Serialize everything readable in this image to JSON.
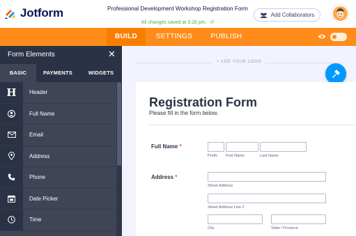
{
  "header": {
    "brand": "Jotform",
    "form_title": "Professional Development Workshop Registration Form",
    "saved_status": "All changes saved at 3:28 pm.",
    "collab_label": "Add Collaborators"
  },
  "nav": {
    "build": "BUILD",
    "settings": "SETTINGS",
    "publish": "PUBLISH"
  },
  "sidebar": {
    "title": "Form Elements",
    "close": "✕",
    "tabs": {
      "basic": "BASIC",
      "payments": "PAYMENTS",
      "widgets": "WIDGETS"
    },
    "items": [
      {
        "label": "Header",
        "icon": "header-icon"
      },
      {
        "label": "Full Name",
        "icon": "user-icon"
      },
      {
        "label": "Email",
        "icon": "envelope-icon"
      },
      {
        "label": "Address",
        "icon": "location-pin-icon"
      },
      {
        "label": "Phone",
        "icon": "phone-icon"
      },
      {
        "label": "Date Picker",
        "icon": "calendar-icon"
      },
      {
        "label": "Time",
        "icon": "clock-icon"
      }
    ]
  },
  "canvas": {
    "add_logo": "+ ADD YOUR LOGO",
    "form": {
      "heading": "Registration Form",
      "subheading": "Please fill in the form below.",
      "full_name": {
        "label": "Full Name",
        "required_mark": "*",
        "sublabels": {
          "prefix": "Prefix",
          "first": "First Name",
          "last": "Last Name"
        }
      },
      "address": {
        "label": "Address",
        "required_mark": "*",
        "sublabels": {
          "street": "Street Address",
          "street2": "Street Address Line 2",
          "city": "City",
          "state": "State / Province"
        }
      }
    }
  },
  "colors": {
    "accent": "#ff8c1a",
    "sidebar": "#3f4457",
    "fab": "#0099ff",
    "saved": "#4caf50"
  }
}
